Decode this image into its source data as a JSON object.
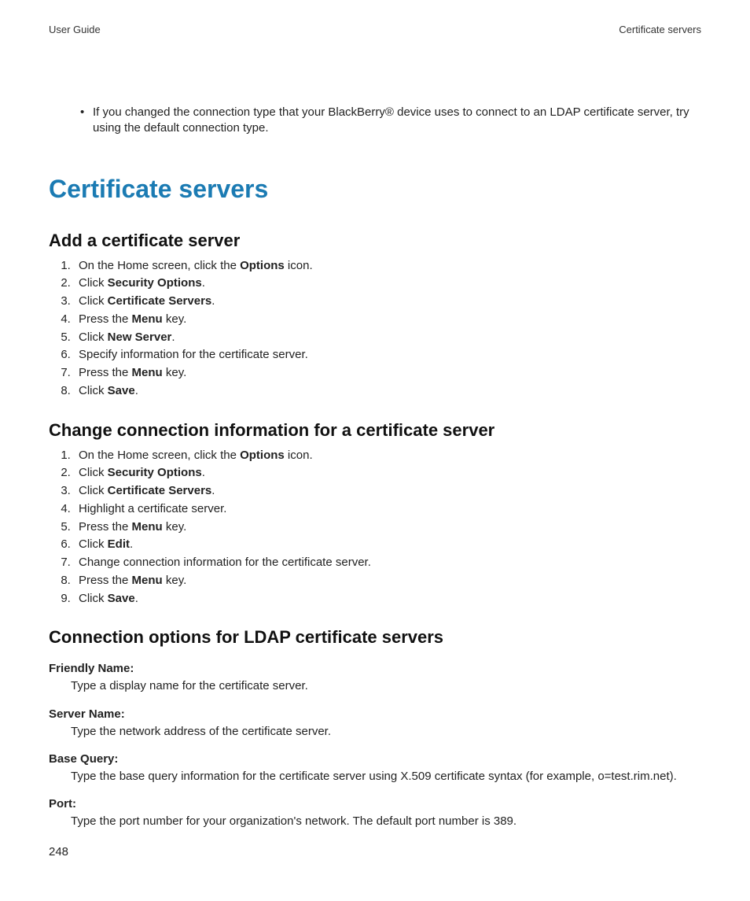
{
  "header": {
    "left": "User Guide",
    "right": "Certificate servers"
  },
  "intro_bullet": "If you changed the connection type that your BlackBerry® device uses to connect to an LDAP certificate server, try using the default connection type.",
  "h1": "Certificate servers",
  "section1": {
    "heading": "Add a certificate server",
    "steps": [
      [
        {
          "t": "On the Home screen, click the "
        },
        {
          "t": "Options",
          "b": true
        },
        {
          "t": " icon."
        }
      ],
      [
        {
          "t": "Click "
        },
        {
          "t": "Security Options",
          "b": true
        },
        {
          "t": "."
        }
      ],
      [
        {
          "t": "Click "
        },
        {
          "t": "Certificate Servers",
          "b": true
        },
        {
          "t": "."
        }
      ],
      [
        {
          "t": "Press the "
        },
        {
          "t": "Menu",
          "b": true
        },
        {
          "t": " key."
        }
      ],
      [
        {
          "t": "Click "
        },
        {
          "t": "New Server",
          "b": true
        },
        {
          "t": "."
        }
      ],
      [
        {
          "t": "Specify information for the certificate server."
        }
      ],
      [
        {
          "t": "Press the "
        },
        {
          "t": "Menu",
          "b": true
        },
        {
          "t": " key."
        }
      ],
      [
        {
          "t": "Click "
        },
        {
          "t": "Save",
          "b": true
        },
        {
          "t": "."
        }
      ]
    ]
  },
  "section2": {
    "heading": "Change connection information for a certificate server",
    "steps": [
      [
        {
          "t": "On the Home screen, click the "
        },
        {
          "t": "Options",
          "b": true
        },
        {
          "t": " icon."
        }
      ],
      [
        {
          "t": "Click "
        },
        {
          "t": "Security Options",
          "b": true
        },
        {
          "t": "."
        }
      ],
      [
        {
          "t": "Click "
        },
        {
          "t": "Certificate Servers",
          "b": true
        },
        {
          "t": "."
        }
      ],
      [
        {
          "t": "Highlight a certificate server."
        }
      ],
      [
        {
          "t": "Press the "
        },
        {
          "t": "Menu",
          "b": true
        },
        {
          "t": " key."
        }
      ],
      [
        {
          "t": "Click "
        },
        {
          "t": "Edit",
          "b": true
        },
        {
          "t": "."
        }
      ],
      [
        {
          "t": "Change connection information for the certificate server."
        }
      ],
      [
        {
          "t": "Press the "
        },
        {
          "t": "Menu",
          "b": true
        },
        {
          "t": " key."
        }
      ],
      [
        {
          "t": "Click "
        },
        {
          "t": "Save",
          "b": true
        },
        {
          "t": "."
        }
      ]
    ]
  },
  "section3": {
    "heading": "Connection options for LDAP certificate servers",
    "defs": [
      {
        "term": "Friendly Name:",
        "body": "Type a display name for the certificate server."
      },
      {
        "term": "Server Name:",
        "body": "Type the network address of the certificate server."
      },
      {
        "term": "Base Query:",
        "body": "Type the base query information for the certificate server using X.509 certificate syntax (for example, o=test.rim.net)."
      },
      {
        "term": "Port:",
        "body": "Type the port number for your organization's network. The default port number is 389."
      }
    ]
  },
  "page_number": "248"
}
